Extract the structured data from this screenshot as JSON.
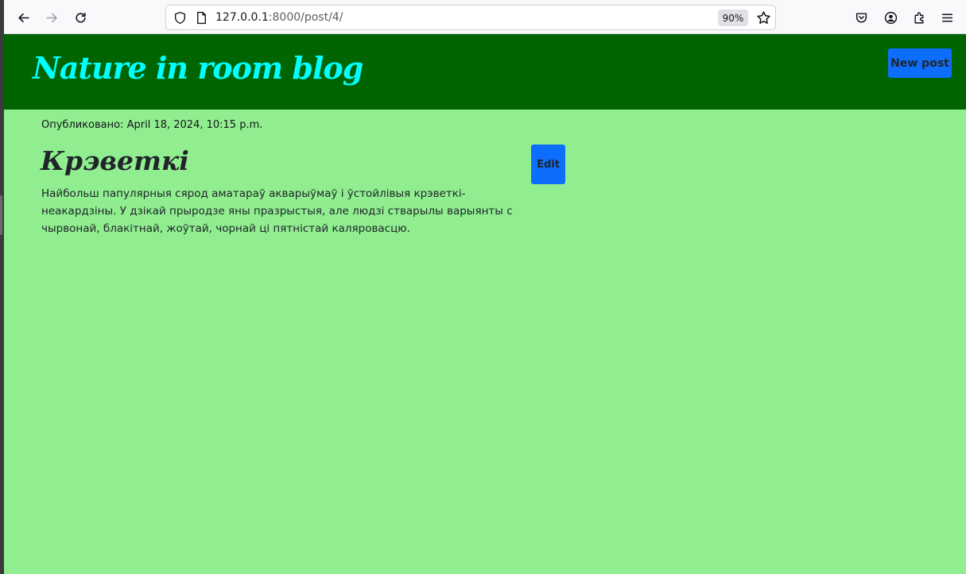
{
  "browser": {
    "url_host": "127.0.0.1",
    "url_path": ":8000/post/4/",
    "zoom": "90%"
  },
  "header": {
    "site_title": "Nature in room blog",
    "new_post_label": "New post"
  },
  "post": {
    "published": "Опубликовано: April 18, 2024, 10:15 p.m.",
    "title": "Крэветкі",
    "edit_label": "Edit",
    "body": "Найбольш папулярныя сярод аматараў акварыўмаў і ўстойлівыя крэветкі- неакардзіны. У дзікай прыродзе яны празрыстыя, але людзі стварылы варыянты с чырвонай, блакітнай, жоўтай, чорнай ці пятністай каляровасцю."
  },
  "colors": {
    "header_bg": "#006400",
    "page_bg": "#90ee90",
    "title_color": "#00ffff",
    "button_bg": "#0d6efd"
  }
}
